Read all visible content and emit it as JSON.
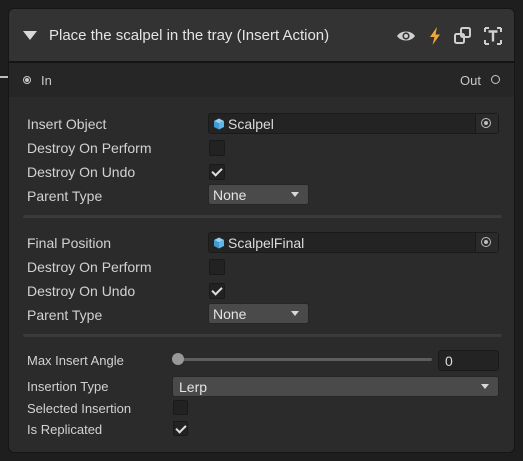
{
  "node": {
    "title": "Place the scalpel in the tray (Insert Action)",
    "header_icons": [
      "eye-icon",
      "lightning-icon",
      "link-icon",
      "text-icon"
    ],
    "ports": {
      "in_label": "In",
      "out_label": "Out"
    }
  },
  "group1": {
    "insert_object_label": "Insert Object",
    "insert_object_value": "Scalpel",
    "destroy_on_perform_label": "Destroy On Perform",
    "destroy_on_perform_checked": false,
    "destroy_on_undo_label": "Destroy On Undo",
    "destroy_on_undo_checked": true,
    "parent_type_label": "Parent Type",
    "parent_type_value": "None"
  },
  "group2": {
    "final_position_label": "Final Position",
    "final_position_value": "ScalpelFinal",
    "destroy_on_perform_label": "Destroy On Perform",
    "destroy_on_perform_checked": false,
    "destroy_on_undo_label": "Destroy On Undo",
    "destroy_on_undo_checked": true,
    "parent_type_label": "Parent Type",
    "parent_type_value": "None"
  },
  "group3": {
    "max_insert_angle_label": "Max Insert Angle",
    "max_insert_angle_value": "0",
    "insertion_type_label": "Insertion Type",
    "insertion_type_value": "Lerp",
    "selected_insertion_label": "Selected Insertion",
    "selected_insertion_checked": false,
    "is_replicated_label": "Is Replicated",
    "is_replicated_checked": true
  },
  "colors": {
    "background": "#1e1e1e",
    "panel": "#2b2b2b",
    "header": "#333333",
    "accent_lightning": "#f0a83a",
    "cube": "#5fb4e8"
  }
}
